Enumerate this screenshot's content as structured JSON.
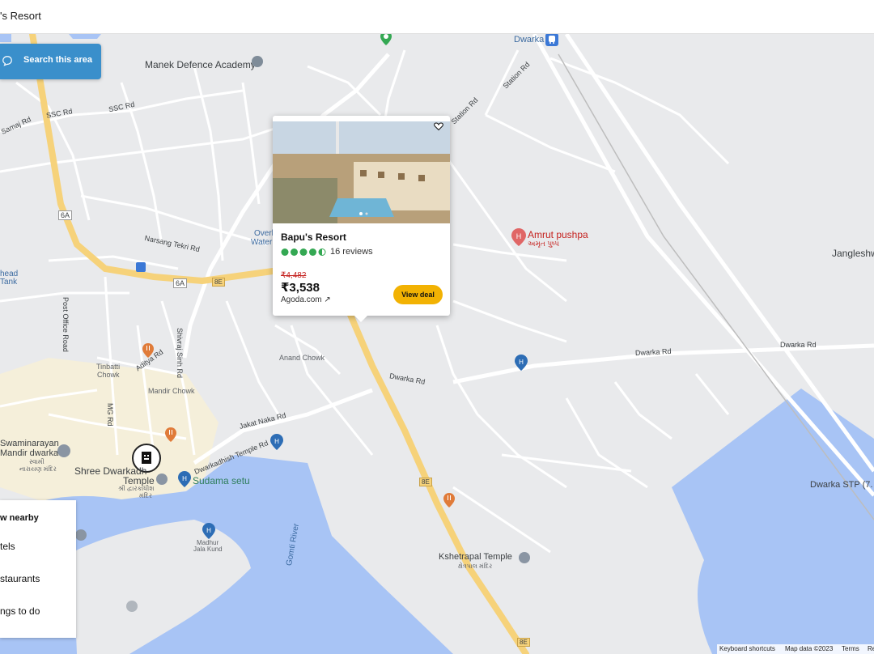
{
  "topbar": {
    "title": "'s Resort"
  },
  "search_area": {
    "label": "Search this area"
  },
  "card": {
    "name": "Bapu's Resort",
    "rating_fraction": 0.9,
    "reviews": "16 reviews",
    "old_price": "₹4,482",
    "price": "₹3,538",
    "provider": "Agoda.com ↗",
    "deal_label": "View deal"
  },
  "nearby": {
    "header": "w nearby",
    "items": [
      "tels",
      "staurants",
      "ngs to do"
    ]
  },
  "map_labels": {
    "dwarka_station": "Dwarka",
    "manek": "Manek Defence Academy",
    "ssc_rd_1": "SSC Rd",
    "ssc_rd_2": "SSC Rd",
    "samaj_rd": "Samaj Rd",
    "station_rd_1": "Station Rd",
    "station_rd_2": "Station Rd",
    "overhead_1": "Overh",
    "overhead_2": "Water",
    "narsang": "Narsang Tekri Rd",
    "head_tank_1": "head",
    "head_tank_2": "Tank",
    "post_office": "Post Office Road",
    "amrut": "Amrut pushpa",
    "amrut_guj": "અમૃત પુષ્પ",
    "jangleshwar": "Jangleshw",
    "anand_chowk": "Anand Chowk",
    "shivraj": "Shivraj Sinh Rd",
    "aditya": "Aditya Rd",
    "tinbatti_1": "Tinbatti",
    "tinbatti_2": "Chowk",
    "mandir_chowk": "Mandir Chowk",
    "mg_rd": "MG Rd",
    "dwarka_rd_1": "Dwarka Rd",
    "dwarka_rd_2": "Dwarka Rd",
    "dwarka_rd_3": "Dwarka Rd",
    "jakat": "Jakat Naka Rd",
    "dwarkadhish_rd": "Dwarkadhish Temple Rd",
    "swaminarayan_1": "Swaminarayan",
    "swaminarayan_2": "Mandir dwarka",
    "swaminarayan_guj_1": "સ્વામી",
    "swaminarayan_guj_2": "નારાયણ મંદિર",
    "shree_1": "Shree Dwarkadh",
    "shree_2": "Temple",
    "shree_guj_1": "શ્રી દ્વારકાધીશ",
    "shree_guj_2": "મંદિર",
    "sudama": "Sudama setu",
    "madhur_1": "Madhur",
    "madhur_2": "Jala Kund",
    "gomti": "Gomti River",
    "kshetrapal": "Kshetrapal Temple",
    "kshetrapal_guj": "ક્ષેત્રપાલ મંદિર",
    "dwarka_stp": "Dwarka STP (7.",
    "shield_6a_1": "6A",
    "shield_6a_2": "6A",
    "shield_8e_1": "8E",
    "shield_8e_2": "8E",
    "shield_8e_3": "8E",
    "shield_8e_4": "8E"
  },
  "attribution": {
    "shortcuts": "Keyboard shortcuts",
    "mapdata": "Map data ©2023",
    "terms": "Terms",
    "report": "Re"
  },
  "colors": {
    "search_button": "#3a8fcb",
    "deal_button": "#f2b203",
    "water": "#a8c4f5",
    "highway": "#f6d27a",
    "rating": "#34a853"
  }
}
